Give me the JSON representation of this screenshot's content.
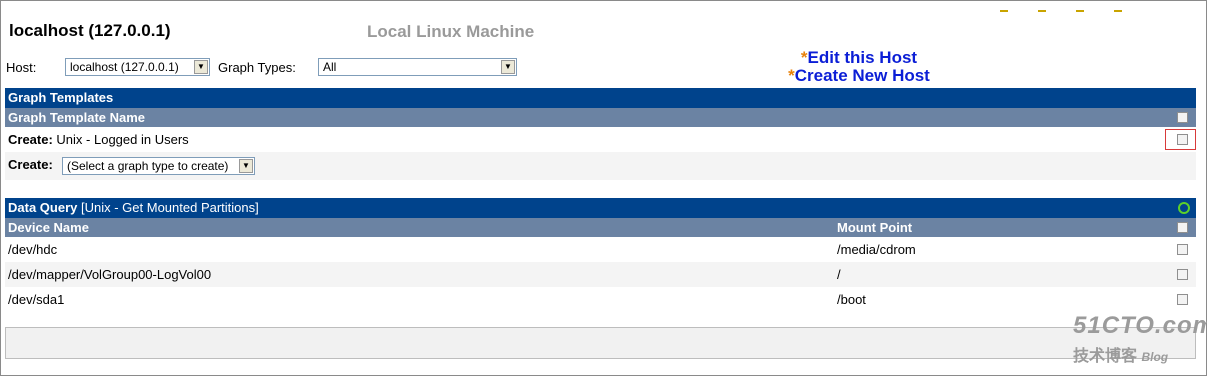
{
  "header": {
    "host_title": "localhost (127.0.0.1)",
    "machine_name": "Local Linux Machine"
  },
  "host_row": {
    "host_label": "Host:",
    "host_value": "localhost (127.0.0.1)",
    "graph_types_label": "Graph Types:",
    "graph_types_value": "All"
  },
  "links": {
    "edit_host": "Edit this Host",
    "create_host": "Create New Host",
    "star": "*"
  },
  "graph_templates": {
    "title": "Graph Templates",
    "column_header": "Graph Template Name",
    "rows": [
      {
        "prefix": "Create:",
        "text": "Unix - Logged in Users"
      }
    ],
    "create_label": "Create:",
    "create_select": "(Select a graph type to create)"
  },
  "data_query": {
    "title": "Data Query",
    "subtitle": "[Unix - Get Mounted Partitions]",
    "columns": [
      "Device Name",
      "Mount Point"
    ],
    "rows": [
      {
        "device": "/dev/hdc",
        "mount": "/media/cdrom"
      },
      {
        "device": "/dev/mapper/VolGroup00-LogVol00",
        "mount": "/"
      },
      {
        "device": "/dev/sda1",
        "mount": "/boot"
      }
    ]
  },
  "watermark": {
    "site": "51CTO.com",
    "sub": "技术博客",
    "blog": "Blog"
  },
  "colors": {
    "header_blue": "#00438c",
    "column_header": "#6b83a3",
    "link_blue": "#0b1ed6",
    "star_orange": "#e8820c",
    "machine_gray": "#9a9a9a"
  }
}
